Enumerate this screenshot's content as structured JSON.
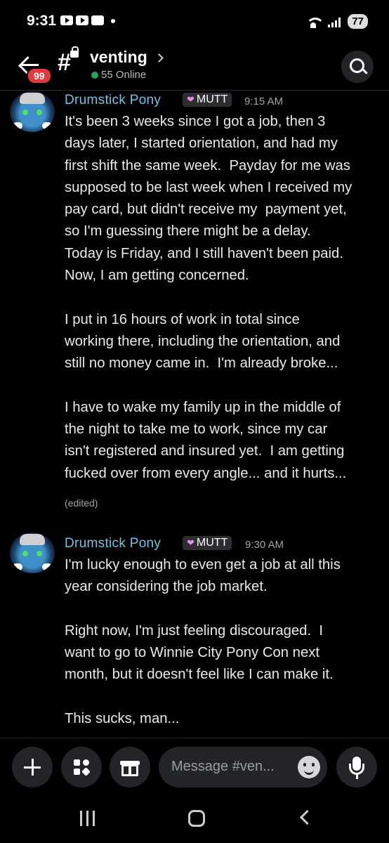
{
  "status_bar": {
    "time": "9:31",
    "battery": "77"
  },
  "header": {
    "back_badge": "99",
    "channel_name": "venting",
    "online_count": "55 Online"
  },
  "messages": [
    {
      "author": "Drumstick Pony",
      "role": "MUTT",
      "timestamp": "9:15 AM",
      "text": "It's been 3 weeks since I got a job, then 3\ndays later, I started orientation, and had my\nfirst shift the same week.  Payday for me was\nsupposed to be last week when I received my\npay card, but didn't receive my  payment yet,\nso I'm guessing there might be a delay.\nToday is Friday, and I still haven't been paid.\nNow, I am getting concerned.\n\nI put in 16 hours of work in total since\nworking there, including the orientation, and\nstill no money came in.  I'm already broke...\n\nI have to wake my family up in the middle of\nthe night to take me to work, since my car\nisn't registered and insured yet.  I am getting\nfucked over from every angle... and it hurts...",
      "edited": "(edited)"
    },
    {
      "author": "Drumstick Pony",
      "role": "MUTT",
      "timestamp": "9:30 AM",
      "text": "I'm lucky enough to even get a job at all this\nyear considering the job market.\n\nRight now, I'm just feeling discouraged.  I\nwant to go to Winnie City Pony Con next\nmonth, but it doesn't feel like I can make it.\n\nThis sucks, man..."
    }
  ],
  "composer": {
    "placeholder": "Message #ven..."
  },
  "colors": {
    "author": "#6fc3e8",
    "online": "#23a55a",
    "badge": "#e0383e",
    "background": "#000000"
  }
}
